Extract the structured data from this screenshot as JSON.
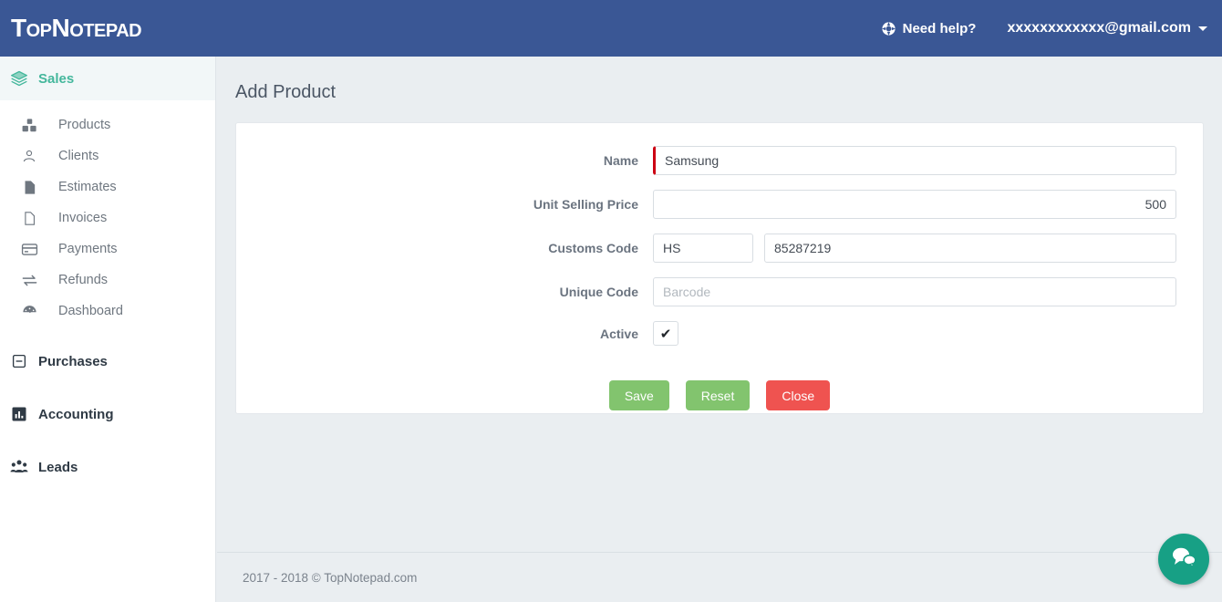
{
  "header": {
    "logo": "TopNotepad",
    "help_label": "Need help?",
    "help_icon": "lifebuoy-icon",
    "user_email": "xxxxxxxxxxxx@gmail.com",
    "caret_icon": "chevron-down-icon",
    "bg_color": "#3a5795"
  },
  "sidebar": {
    "groups": [
      {
        "label": "Sales",
        "icon": "layers-icon",
        "active": true,
        "accent_color": "#44b79c"
      },
      {
        "label": "Purchases",
        "icon": "minus-square-icon",
        "active": false
      },
      {
        "label": "Accounting",
        "icon": "bar-chart-icon",
        "active": false
      },
      {
        "label": "Leads",
        "icon": "users-group-icon",
        "active": false
      }
    ],
    "sales_items": [
      {
        "label": "Products",
        "icon": "cubes-icon"
      },
      {
        "label": "Clients",
        "icon": "user-circle-icon"
      },
      {
        "label": "Estimates",
        "icon": "file-filled-icon"
      },
      {
        "label": "Invoices",
        "icon": "file-outline-icon"
      },
      {
        "label": "Payments",
        "icon": "credit-card-icon"
      },
      {
        "label": "Refunds",
        "icon": "exchange-arrows-icon"
      },
      {
        "label": "Dashboard",
        "icon": "gauge-icon"
      }
    ]
  },
  "main": {
    "page_title": "Add Product",
    "form": {
      "name": {
        "label": "Name",
        "value": "Samsung",
        "placeholder": "",
        "required": true,
        "required_color": "#cc0013"
      },
      "unit_selling_price": {
        "label": "Unit Selling Price",
        "value": "500",
        "placeholder": ""
      },
      "customs_code": {
        "label": "Customs Code",
        "prefix_value": "HS",
        "prefix_placeholder": "",
        "value": "85287219",
        "placeholder": ""
      },
      "unique_code": {
        "label": "Unique Code",
        "value": "",
        "placeholder": "Barcode"
      },
      "active": {
        "label": "Active",
        "checked": true,
        "check_glyph": "✔"
      }
    },
    "buttons": {
      "save": {
        "label": "Save",
        "color": "#82c46e"
      },
      "reset": {
        "label": "Reset",
        "color": "#82c46e"
      },
      "close": {
        "label": "Close",
        "color": "#ef5350"
      }
    }
  },
  "footer": {
    "copyright": "2017 - 2018 © TopNotepad.com"
  },
  "chat": {
    "icon": "chat-bubbles-icon",
    "color": "#17a085"
  }
}
